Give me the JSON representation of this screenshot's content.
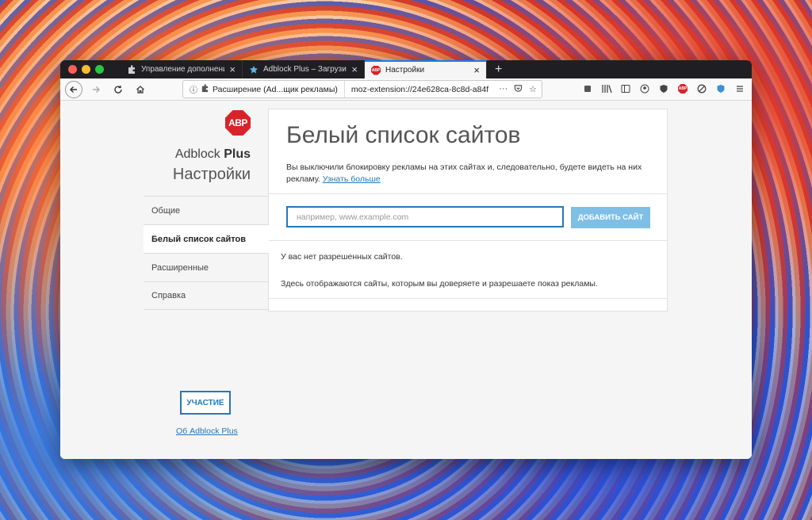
{
  "tabs": [
    {
      "title": "Управление дополнениями",
      "icon": "puzzle-icon"
    },
    {
      "title": "Adblock Plus – Загрузите это р",
      "icon": "addon-icon"
    },
    {
      "title": "Настройки",
      "icon": "abp-icon"
    }
  ],
  "tabs_new": "+",
  "urlbar": {
    "identity": "Расширение (Ad...щик рекламы)",
    "url": "moz-extension://24e628ca-8c8d-a84f",
    "more": "···"
  },
  "sidebar": {
    "logo_text": "ABP",
    "brand_name": "Adblock",
    "brand_bold": "Plus",
    "title": "Настройки",
    "items": [
      {
        "label": "Общие"
      },
      {
        "label": "Белый список сайтов"
      },
      {
        "label": "Расширенные"
      },
      {
        "label": "Справка"
      }
    ],
    "contribute": "УЧАСТИЕ",
    "about": "Об Adblock Plus"
  },
  "content": {
    "heading": "Белый список сайтов",
    "description": "Вы выключили блокировку рекламы на этих сайтах и, следовательно, будете видеть на них рекламу.",
    "learn_more": "Узнать больше",
    "input_placeholder": "например, www.example.com",
    "add_button": "ДОБАВИТЬ САЙТ",
    "empty_title": "У вас нет разрешенных сайтов.",
    "empty_hint": "Здесь отображаются сайты, которым вы доверяете и разрешаете показ рекламы."
  },
  "colors": {
    "accent": "#2678b5",
    "abp_red": "#d9232a",
    "button_disabled": "#7fbfe6"
  }
}
